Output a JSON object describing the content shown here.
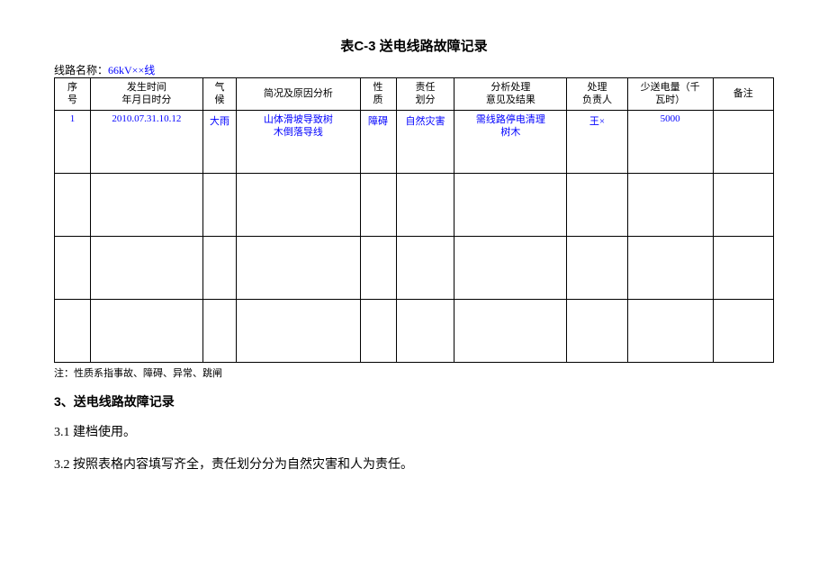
{
  "title": "表C-3  送电线路故障记录",
  "line_name_label": "线路名称：",
  "line_name_value": "66kV××线",
  "headers": {
    "seq": "序\n号",
    "time": "发生时间\n年月日时分",
    "weather": "气\n候",
    "analysis": "简况及原因分析",
    "nature": "性\n质",
    "responsibility": "责任\n划分",
    "opinion": "分析处理\n意见及结果",
    "charge": "处理\n负责人",
    "power": "少送电量（千\n瓦时）",
    "remark": "备注"
  },
  "row1": {
    "seq": "1",
    "time": "2010.07.31.10.12",
    "weather": "大雨",
    "analysis_line1": "山体滑坡导致树",
    "analysis_line2": "木倒落导线",
    "nature": "障碍",
    "responsibility": "自然灾害",
    "opinion_line1": "需线路停电清理",
    "opinion_line2": "树木",
    "charge": "王×",
    "power": "5000",
    "remark": ""
  },
  "note": "注：性质系指事故、障碍、异常、跳闸",
  "section_heading": "3、送电线路故障记录",
  "para1": "3.1 建档使用。",
  "para2": "3.2 按照表格内容填写齐全，责任划分分为自然灾害和人为责任。"
}
